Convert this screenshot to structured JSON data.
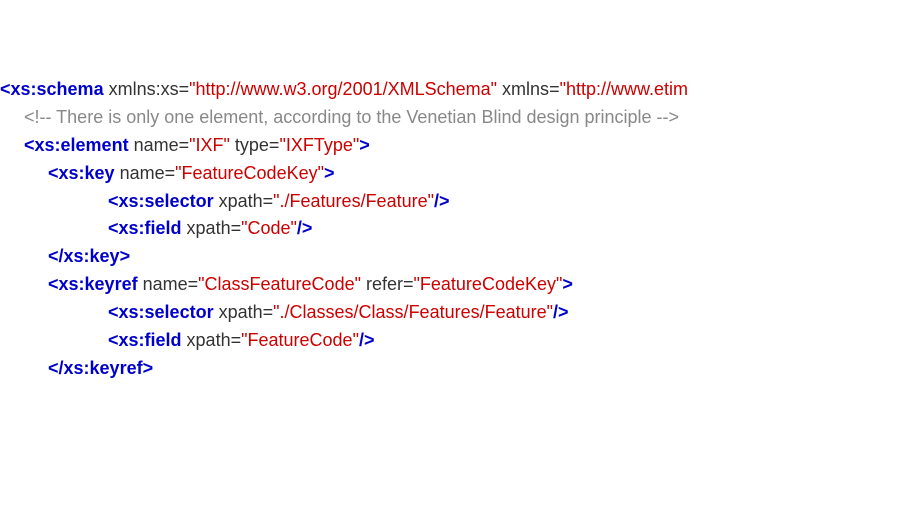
{
  "lines": [
    {
      "indent": 0,
      "type": "open",
      "tag": "xs:schema",
      "attrs": [
        {
          "name": "xmlns:xs",
          "value": "http://www.w3.org/2001/XMLSchema",
          "close": "\""
        },
        {
          "name": "xmlns",
          "value": "http://www.etim",
          "close": ""
        }
      ],
      "selfclose": false,
      "terminated": false
    },
    {
      "indent": 1,
      "type": "comment",
      "text": "<!-- There is only one element, according to the Venetian Blind design principle -->"
    },
    {
      "indent": 1,
      "type": "open",
      "tag": "xs:element",
      "attrs": [
        {
          "name": "name",
          "value": "IXF",
          "close": "\""
        },
        {
          "name": "type",
          "value": "IXFType",
          "close": "\""
        }
      ],
      "selfclose": false,
      "terminated": true
    },
    {
      "indent": 2,
      "type": "open",
      "tag": "xs:key",
      "attrs": [
        {
          "name": "name",
          "value": "FeatureCodeKey",
          "close": "\""
        }
      ],
      "selfclose": false,
      "terminated": true
    },
    {
      "indent": 4,
      "type": "open",
      "tag": "xs:selector",
      "attrs": [
        {
          "name": "xpath",
          "value": "./Features/Feature",
          "close": "\""
        }
      ],
      "selfclose": true,
      "terminated": true
    },
    {
      "indent": 4,
      "type": "open",
      "tag": "xs:field",
      "attrs": [
        {
          "name": "xpath",
          "value": "Code",
          "close": "\""
        }
      ],
      "selfclose": true,
      "terminated": true
    },
    {
      "indent": 2,
      "type": "close",
      "tag": "xs:key"
    },
    {
      "indent": 2,
      "type": "open",
      "tag": "xs:keyref",
      "attrs": [
        {
          "name": "name",
          "value": "ClassFeatureCode",
          "close": "\""
        },
        {
          "name": "refer",
          "value": "FeatureCodeKey",
          "close": "\""
        }
      ],
      "selfclose": false,
      "terminated": true
    },
    {
      "indent": 4,
      "type": "open",
      "tag": "xs:selector",
      "attrs": [
        {
          "name": "xpath",
          "value": "./Classes/Class/Features/Feature",
          "close": "\""
        }
      ],
      "selfclose": true,
      "terminated": true
    },
    {
      "indent": 4,
      "type": "open",
      "tag": "xs:field",
      "attrs": [
        {
          "name": "xpath",
          "value": "FeatureCode",
          "close": "\""
        }
      ],
      "selfclose": true,
      "terminated": true
    },
    {
      "indent": 2,
      "type": "close",
      "tag": "xs:keyref"
    }
  ]
}
